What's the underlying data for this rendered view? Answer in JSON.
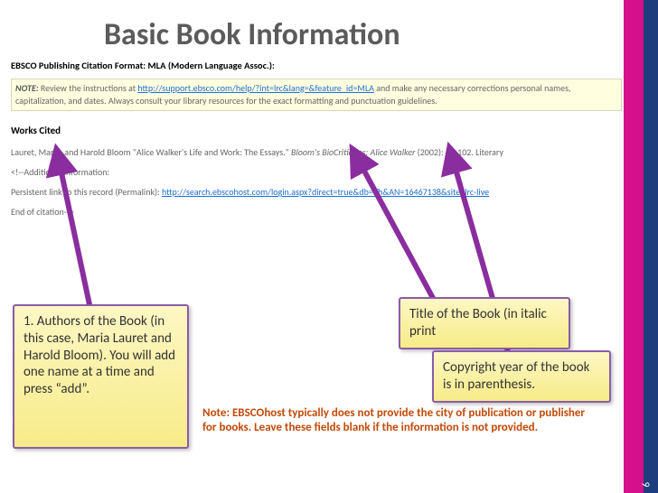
{
  "title": "Basic Book Information",
  "page_number": "6",
  "ebsco": {
    "header": "EBSCO Publishing   Citation Format: MLA (Modern Language Assoc.):",
    "note_label": "NOTE:",
    "note_text_pre": " Review the instructions at ",
    "note_link": "http://support.ebsco.com/help/?int=lrc&lang=&feature_id=MLA",
    "note_text_post": " and make any necessary corrections personal names, capitalization, and dates. Always consult your library resources for the exact formatting and punctuation guidelines.",
    "works_cited": "Works Cited",
    "citation_pre": "Lauret, Maria, and Harold Bloom \"Alice Walker's Life and Work: The Essays.\" ",
    "citation_italic": "Bloom's BioCritiques: Alice Walker",
    "citation_post": " (2002): 75-102. Literary",
    "ai_open": "<!--Additional Information:",
    "permalink_label": "Persistent link to this record (Permalink): ",
    "permalink_url": "http://search.ebscohost.com/login.aspx?direct=true&db=lfh&AN=16467138&site=lrc-live",
    "ai_close": "End of citation-->"
  },
  "callouts": {
    "authors": "1.  Authors of the Book  (in this case, Maria Lauret and Harold Bloom).  You will add one name at a time and press “add”.",
    "title_note": "Title of the Book (in italic print",
    "copyright": "Copyright year of the book is in parenthesis."
  },
  "footnote": "Note:  EBSCOhost typically does not provide the city of publication or publisher for books.  Leave these fields blank if the information is not provided.",
  "colors": {
    "accent_pink": "#d60f8c",
    "accent_blue": "#1d3d7c",
    "arrow_purple": "#8a2d9e",
    "callout_border": "#8a5ca8",
    "footnote_color": "#c24a09"
  }
}
